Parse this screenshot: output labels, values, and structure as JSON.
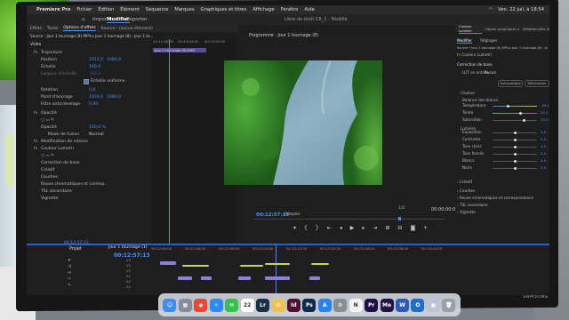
{
  "menubar": {
    "app": "Premiere Pro",
    "items": [
      "Fichier",
      "Édition",
      "Élément",
      "Séquence",
      "Marques",
      "Graphiques et titres",
      "Affichage",
      "Fenêtre",
      "Aide"
    ],
    "clock": "Ven. 22 juil. à 18:54"
  },
  "workspace": {
    "tabs": [
      "Importer",
      "Modifier",
      "Exporter"
    ],
    "active": "Modifier",
    "doc_title": "Libre de droit CR_1 - Modifié"
  },
  "effect_panel": {
    "tabs": [
      "Effets",
      "Texte",
      "Options d'effets",
      "Source : (aucun élément)"
    ],
    "source_line": "Source : Jour 1 tournage (8).MP4 ▸ Jour 1 tournage (8) : Jour 1 to...",
    "ruler_tc": [
      "00:12:48:00",
      "00:13:04:00",
      "00:13:20:00"
    ],
    "clip_label": "Jour 1 tournage (8).MP4",
    "section_video": "Vidéo",
    "rows": [
      {
        "label": "Trajectoire",
        "kind": "fx"
      },
      {
        "label": "Position",
        "v1": "1915,0",
        "v2": "1080,0"
      },
      {
        "label": "Échelle",
        "v1": "100,0"
      },
      {
        "label": "Largeur d'échelle",
        "v1": "100,0"
      },
      {
        "label": "Échelle uniforme",
        "kind": "check"
      },
      {
        "label": "Rotation",
        "v1": "0,0"
      },
      {
        "label": "Point d'ancrage",
        "v1": "1920,0",
        "v2": "1080,0"
      },
      {
        "label": "Filtre anticrénelage",
        "v1": "0,00"
      },
      {
        "label": "Opacité",
        "kind": "fx"
      },
      {
        "label": "Opacité",
        "v1": "100,0 %"
      },
      {
        "label": "Mode de fusion",
        "v1": "Normal"
      },
      {
        "label": "Modification de vitesse",
        "kind": "fx"
      },
      {
        "label": "Couleur Lumetri",
        "kind": "fx"
      },
      {
        "label": "Correction de base"
      },
      {
        "label": "Créatif"
      },
      {
        "label": "Courbes"
      },
      {
        "label": "Roues chromatiques et corresp."
      },
      {
        "label": "TSL secondaire"
      },
      {
        "label": "Vignette"
      }
    ]
  },
  "program": {
    "title": "Programme : Jour 1 tournage (8)",
    "timecode": "00:12:57:13",
    "fit": "Adapter",
    "ratio": "1/2",
    "duration": "00:00:00:01"
  },
  "lumetri": {
    "tabs": [
      "Couleur Lumetri",
      "Objets graphiques essentiels",
      "Métadonnées de l'élément"
    ],
    "subtabs": [
      "Modifier",
      "Réglages"
    ],
    "source": "Source • Jour 1 tournage (8).MP4 ▸ Jour 1 tournage (8) : Jour 1 tournage (8).MP4",
    "fx_label": "Couleur Lumetri",
    "section": "Correction de base",
    "lut_label": "LUT en entrée",
    "lut_value": "Aucun",
    "btn_auto": "Automatique",
    "btn_reset": "Réinitialiser",
    "sub_color": "Couleur",
    "wb_label": "Balance des blancs",
    "sub_light": "Lumière",
    "sliders": [
      {
        "label": "Température",
        "value": "-39,0",
        "pos": 0.35
      },
      {
        "label": "Teinte",
        "value": "23,3",
        "pos": 0.62
      },
      {
        "label": "Saturation",
        "value": "123,9",
        "pos": 0.7
      },
      {
        "label": "Exposition",
        "value": "0,0",
        "pos": 0.5
      },
      {
        "label": "Contraste",
        "value": "0,0",
        "pos": 0.5
      },
      {
        "label": "Tons clairs",
        "value": "0,0",
        "pos": 0.5
      },
      {
        "label": "Tons foncés",
        "value": "0,0",
        "pos": 0.5
      },
      {
        "label": "Blancs",
        "value": "0,0",
        "pos": 0.5
      },
      {
        "label": "Noirs",
        "value": "0,0",
        "pos": 0.5
      }
    ],
    "sections_bottom": [
      "Créatif",
      "Courbes",
      "Roues chromatiques et correspondance",
      "TSL secondaire",
      "Vignette"
    ]
  },
  "timeline": {
    "project_tab": "Projet",
    "project_tc": "00:12:57:13",
    "sequence_tab": "Jour 1 tournage (1)",
    "timecode": "00:12:57:13",
    "ruler": [
      "00:12:40:00",
      "00:12:48:00",
      "00:12:56:00",
      "00:13:04:00",
      "00:13:12:00",
      "00:13:20:00",
      "00:13:28:00",
      "00:13:36:00",
      "00:13:44:00"
    ],
    "tracks": [
      "V3",
      "V2",
      "V1",
      "A1",
      "A2",
      "A3"
    ]
  },
  "dock": {
    "apps": [
      {
        "name": "finder-icon",
        "color": "#3d8fe8",
        "glyph": "☺"
      },
      {
        "name": "launchpad-icon",
        "color": "#8a8a9a",
        "glyph": "▦"
      },
      {
        "name": "chrome-icon",
        "color": "#e9463a",
        "glyph": "◉"
      },
      {
        "name": "safari-icon",
        "color": "#2e8bf0",
        "glyph": "✧"
      },
      {
        "name": "messages-icon",
        "color": "#36c24a",
        "glyph": "✉"
      },
      {
        "name": "calendar-icon",
        "color": "#ffffff",
        "glyph": "22"
      },
      {
        "name": "lightroom-icon",
        "color": "#1c2f48",
        "glyph": "Lr"
      },
      {
        "name": "photos-icon",
        "color": "#f2c14e",
        "glyph": "✿"
      },
      {
        "name": "indesign-icon",
        "color": "#4a1330",
        "glyph": "Id"
      },
      {
        "name": "photoshop-icon",
        "color": "#0f2a4a",
        "glyph": "Ps"
      },
      {
        "name": "appstore-icon",
        "color": "#2a82f0",
        "glyph": "A"
      },
      {
        "name": "settings-icon",
        "color": "#8a8d92",
        "glyph": "⚙"
      },
      {
        "name": "notion-icon",
        "color": "#f4f4f4",
        "glyph": "N"
      },
      {
        "name": "premiere-icon",
        "color": "#1f0f45",
        "glyph": "Pr"
      },
      {
        "name": "mediaencoder-icon",
        "color": "#201545",
        "glyph": "Me"
      },
      {
        "name": "word-icon",
        "color": "#2b5cb8",
        "glyph": "W"
      },
      {
        "name": "outlook-icon",
        "color": "#1e6fc9",
        "glyph": "O"
      },
      {
        "name": "preview-icon",
        "color": "#b8c6d8",
        "glyph": "▣"
      },
      {
        "name": "trash-icon",
        "color": "#9aa0a8",
        "glyph": "🗑"
      }
    ]
  },
  "monitor_brand": "SAMSUNG"
}
